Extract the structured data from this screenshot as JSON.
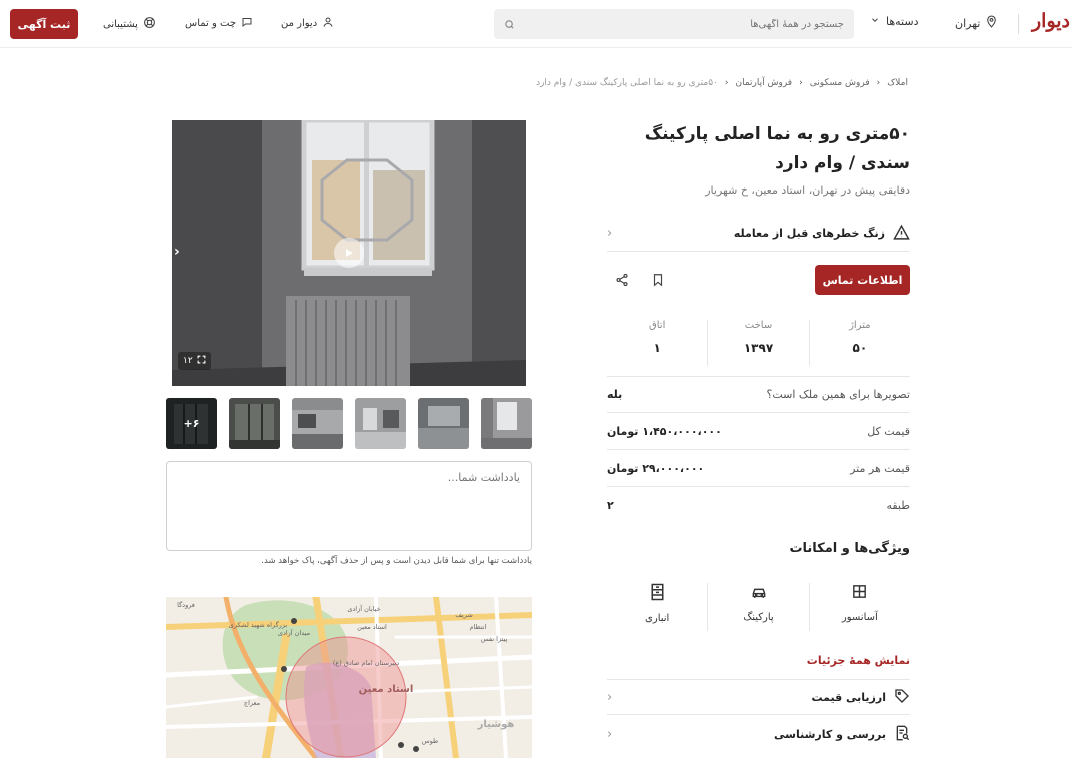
{
  "header": {
    "logo": "دیوار",
    "city": "تهران",
    "categories": "دسته‌ها",
    "search_placeholder": "جستجو در همهٔ آگهی‌ها",
    "my_divar": "دیوار من",
    "chat": "چت و تماس",
    "support": "پشتیبانی",
    "post_ad": "ثبت آگهی"
  },
  "breadcrumb": [
    "املاک",
    "فروش مسکونی",
    "فروش آپارتمان",
    "۵۰متری رو به نما اصلی پارکینگ سندی / وام دارد"
  ],
  "listing": {
    "title": "۵۰متری رو به نما اصلی پارکینگ سندی / وام دارد",
    "subtitle": "دقایقی پیش در تهران، استاد معین، خ شهریار",
    "warning": "زنگ خطرهای قبل از معامله",
    "contact_button": "اطلاعات تماس"
  },
  "stats": [
    {
      "label": "متراژ",
      "value": "۵۰"
    },
    {
      "label": "ساخت",
      "value": "۱۳۹۷"
    },
    {
      "label": "اتاق",
      "value": "۱"
    }
  ],
  "info": [
    {
      "key": "تصویرها برای همین ملک است؟",
      "value": "بله"
    },
    {
      "key": "قیمت کل",
      "value": "۱،۴۵۰،۰۰۰،۰۰۰ تومان"
    },
    {
      "key": "قیمت هر متر",
      "value": "۲۹،۰۰۰،۰۰۰ تومان"
    },
    {
      "key": "طبقه",
      "value": "۲"
    }
  ],
  "features": {
    "title": "ویژگی‌ها و امکانات",
    "items": [
      {
        "label": "آسانسور",
        "icon": "elevator-icon"
      },
      {
        "label": "پارکینگ",
        "icon": "car-icon"
      },
      {
        "label": "انباری",
        "icon": "storage-icon"
      }
    ],
    "show_all": "نمایش همهٔ جزئیات"
  },
  "links": {
    "price_evaluation": "ارزیابی قیمت",
    "review": "بررسی و کارشناسی"
  },
  "gallery": {
    "image_count": "۱۲",
    "more_thumbs": "+۶"
  },
  "note": {
    "placeholder": "یادداشت شما...",
    "hint": "یادداشت تنها برای شما قابل دیدن است و پس از حذف آگهی، پاک خواهد شد."
  },
  "map": {
    "labels": {
      "district": "استاد معین",
      "azadi": "میدان آزادی",
      "azadi_street": "خیابان آزادی",
      "school": "دبیرستان امام صادق (ع)",
      "lashkari": "بزرگراه شهید لشکری",
      "hoshiyar": "هوشیار",
      "tous": "طوس",
      "meraj": "معراج",
      "ostad_moein": "استاد معین",
      "forudgah": "فرودگا",
      "sharif": "شریف",
      "pizza": "پیتزا نفس",
      "entezam": "انتظام"
    }
  }
}
